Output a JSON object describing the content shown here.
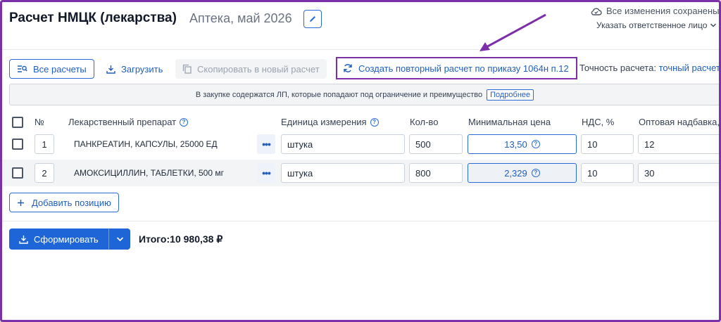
{
  "header": {
    "title": "Расчет НМЦК (лекарства)",
    "subtitle": "Аптека, май 2026",
    "save_status": "Все изменения сохранены",
    "responsible_label": "Указать ответственное лицо"
  },
  "toolbar": {
    "all_calcs": "Все расчеты",
    "upload": "Загрузить",
    "copy_new": "Скопировать в новый расчет",
    "repeat_calc": "Создать повторный расчет по приказу 1064н п.12",
    "accuracy_label": "Точность расчета:",
    "accuracy_value": "точный расчет"
  },
  "notice": {
    "text": "В закупке содержатся ЛП, которые попадают под ограничение и преимущество",
    "more": "Подробнее"
  },
  "table": {
    "columns": {
      "num": "№",
      "drug": "Лекарственный препарат",
      "unit": "Единица измерения",
      "qty": "Кол-во",
      "min_price": "Минимальная цена",
      "vat": "НДС, %",
      "markup": "Оптовая надбавка,"
    },
    "rows": [
      {
        "num": "1",
        "drug": "ПАНКРЕАТИН, КАПСУЛЫ, 25000 ЕД",
        "unit": "штука",
        "qty": "500",
        "min_price": "13,50",
        "vat": "10",
        "markup": "12"
      },
      {
        "num": "2",
        "drug": "АМОКСИЦИЛЛИН, ТАБЛЕТКИ, 500 мг",
        "unit": "штука",
        "qty": "800",
        "min_price": "2,329",
        "vat": "10",
        "markup": "30"
      }
    ]
  },
  "actions": {
    "add_position": "Добавить позицию",
    "generate": "Сформировать",
    "total_label": "Итого:",
    "total_value": "10 980,38 ₽"
  },
  "colors": {
    "accent": "#1e66d8",
    "annotation": "#7b2fa8"
  }
}
